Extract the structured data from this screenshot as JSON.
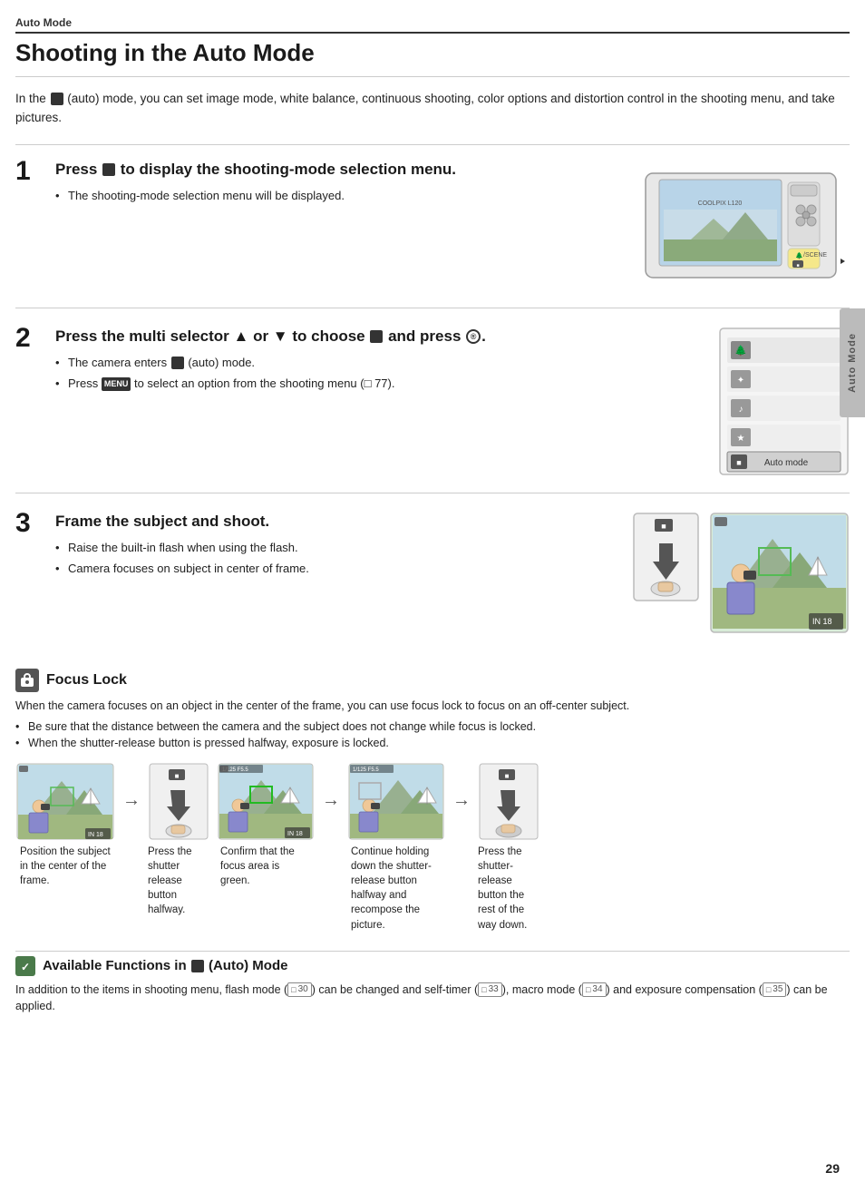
{
  "header": {
    "section_label": "Auto Mode",
    "page_title": "Shooting in the Auto Mode"
  },
  "intro": {
    "text": "In the  (auto) mode, you can set image mode, white balance, continuous shooting, color options and distortion control in the shooting menu, and take pictures."
  },
  "steps": [
    {
      "number": "1",
      "title": "Press  to display the shooting-mode selection menu.",
      "bullets": [
        "The shooting-mode selection menu will be displayed."
      ]
    },
    {
      "number": "2",
      "title": "Press the multi selector ▲ or ▼ to choose  and press ®.",
      "bullets": [
        "The camera enters  (auto) mode.",
        "Press MENU to select an option from the shooting menu (□ 77)."
      ],
      "mode_label": "Auto mode"
    },
    {
      "number": "3",
      "title": "Frame the subject and shoot.",
      "bullets": [
        "Raise the built-in flash when using the flash.",
        "Camera focuses on subject in center of frame."
      ]
    }
  ],
  "focus_lock": {
    "title": "Focus Lock",
    "description": "When the camera focuses on an object in the center of the frame, you can use focus lock to focus on an off-center subject.",
    "bullets": [
      "Be sure that the distance between the camera and the subject does not change while focus is locked.",
      "When the shutter-release button is pressed halfway, exposure is locked."
    ],
    "steps": [
      {
        "caption": "Position the subject in the center of the frame."
      },
      {
        "caption": "Press the shutter release button halfway."
      },
      {
        "caption": "Confirm that the focus area is green."
      },
      {
        "caption": "Continue holding down the shutter-release button halfway and recompose the picture."
      },
      {
        "caption": "Press the shutter-release button the rest of the way down."
      }
    ]
  },
  "available_functions": {
    "title": "Available Functions in  (Auto) Mode",
    "text": "In addition to the items in shooting menu, flash mode (□ 30) can be changed and self-timer (□ 33), macro mode (□ 34) and exposure compensation (□ 35) can be applied."
  },
  "side_tab": {
    "label": "Auto Mode"
  },
  "page_number": "29"
}
